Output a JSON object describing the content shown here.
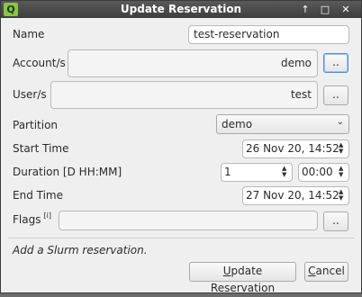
{
  "window": {
    "title": "Update Reservation",
    "icon_letter": "Q",
    "controls": {
      "pin": "↑",
      "maximize": "□",
      "close": "✕"
    }
  },
  "form": {
    "name": {
      "label": "Name",
      "value": "test-reservation"
    },
    "accounts": {
      "label": "Account/s",
      "value": "demo",
      "button": ".."
    },
    "users": {
      "label": "User/s",
      "value": "test",
      "button": ".."
    },
    "partition": {
      "label": "Partition",
      "value": "demo"
    },
    "start_time": {
      "label": "Start Time",
      "value": "26 Nov 20, 14:52"
    },
    "duration": {
      "label": "Duration [D HH:MM]",
      "days": "1",
      "time": "00:00"
    },
    "end_time": {
      "label": "End Time",
      "value": "27 Nov 20, 14:52"
    },
    "flags": {
      "label": "Flags",
      "info": "[i]",
      "value": "",
      "button": ".."
    }
  },
  "status": {
    "text": "Add a Slurm reservation."
  },
  "footer": {
    "update_button_pre": "",
    "update_button_ul": "U",
    "update_button_rest": "pdate Reservation",
    "cancel_button_ul": "C",
    "cancel_button_rest": "ancel"
  }
}
